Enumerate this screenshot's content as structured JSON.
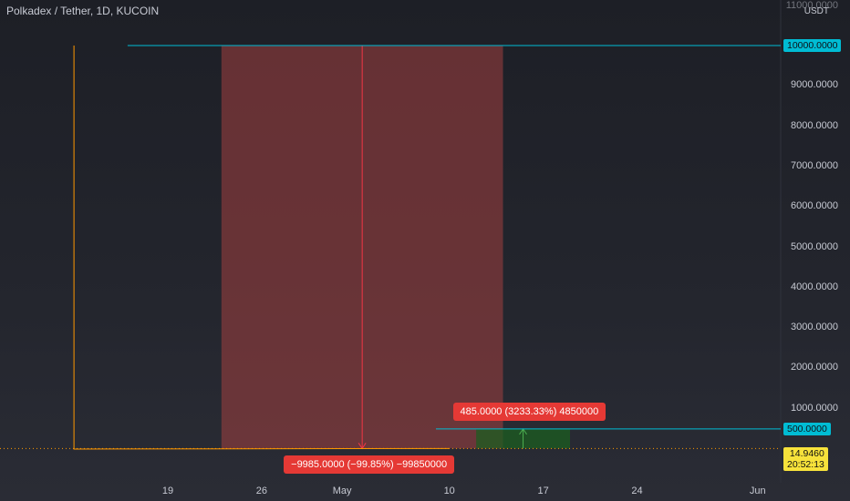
{
  "header": {
    "title": "Polkadex / Tether, 1D, KUCOIN"
  },
  "axis": {
    "unit": "USDT",
    "top_clipped_label": "11000.0000"
  },
  "price_tags": {
    "upper_level": "10000.0000",
    "lower_level": "500.0000",
    "current_price": "14.9460",
    "countdown": "20:52:13"
  },
  "measurements": {
    "drop_label": "−9985.0000 (−99.85%) −99850000",
    "rise_label": "485.0000 (3233.33%) 4850000"
  },
  "colors": {
    "cyan": "#00bcd4",
    "orange": "#ff9800",
    "red_zone": "#a23f40",
    "red_line": "#f23645",
    "green_zone": "#1b5e20",
    "green_line": "#4caf50",
    "yellow": "#f7e23b"
  },
  "chart_data": {
    "type": "line",
    "title": "Polkadex / Tether, 1D, KUCOIN",
    "ylabel": "USDT",
    "ylim": [
      0,
      11000
    ],
    "yticks": [
      1000,
      2000,
      3000,
      4000,
      5000,
      6000,
      7000,
      8000,
      9000,
      10000
    ],
    "ytick_labels": [
      "1000.0000",
      "2000.0000",
      "3000.0000",
      "4000.0000",
      "5000.0000",
      "6000.0000",
      "7000.0000",
      "8000.0000",
      "9000.0000",
      "10000.0000"
    ],
    "xticks": [
      "19",
      "26",
      "May",
      "10",
      "17",
      "24",
      "Jun"
    ],
    "xticks_day": [
      19,
      26,
      32,
      40,
      47,
      54,
      63
    ],
    "series": [
      {
        "values": [
          [
            12,
            10000
          ],
          [
            12,
            0
          ],
          [
            40,
            15
          ]
        ]
      }
    ],
    "horizontal_lines": [
      {
        "value": 10000,
        "label": "10000.0000",
        "x_start_day": 16
      },
      {
        "value": 500,
        "label": "500.0000",
        "x_start_day": 39
      },
      {
        "value": 14.946,
        "label": "14.9460",
        "style": "dotted"
      }
    ],
    "measure_ranges": [
      {
        "kind": "drop",
        "x_start_day": 23,
        "x_end_day": 44,
        "y_from": 10000,
        "y_to": 15,
        "label": "−9985.0000 (−99.85%) −99850000"
      },
      {
        "kind": "rise",
        "x_start_day": 42,
        "x_end_day": 49,
        "y_from": 15,
        "y_to": 500,
        "label": "485.0000 (3233.33%) 4850000"
      }
    ]
  }
}
